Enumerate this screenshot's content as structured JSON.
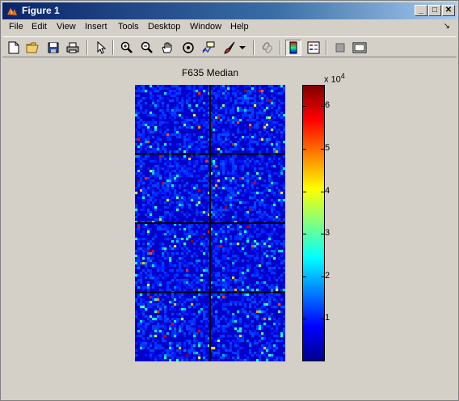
{
  "window": {
    "title": "Figure 1",
    "controls": {
      "minimize": "_",
      "maximize": "□",
      "close": "✕"
    }
  },
  "menubar": {
    "items": [
      "File",
      "Edit",
      "View",
      "Insert",
      "Tools",
      "Desktop",
      "Window",
      "Help"
    ],
    "dock_arrow": "↘"
  },
  "toolbar": {
    "icons": [
      "new-file-icon",
      "open-folder-icon",
      "save-icon",
      "print-icon",
      "pointer-icon",
      "zoom-in-icon",
      "zoom-out-icon",
      "pan-hand-icon",
      "rotate-3d-icon",
      "data-cursor-icon",
      "brush-icon",
      "brush-dropdown-icon",
      "link-icon",
      "colorbar-icon",
      "legend-icon",
      "hide-tools-icon",
      "show-tools-icon"
    ]
  },
  "colors": {
    "title_bar_start": "#0a246a",
    "title_bar_end": "#a6caf0",
    "background": "#d4d0c8",
    "heatmap_base": "#0000c8",
    "grid_line": "#000000"
  },
  "chart_data": {
    "type": "heatmap",
    "title": "F635 Median",
    "colorbar": {
      "exponent_label": "x 10",
      "exponent_power": "4",
      "ticks": [
        "1",
        "2",
        "3",
        "4",
        "5",
        "6"
      ],
      "tick_values": [
        10000,
        20000,
        30000,
        40000,
        50000,
        60000
      ],
      "range": [
        0,
        65000
      ],
      "colormap": "jet"
    },
    "grid_blocks": {
      "rows": 4,
      "cols": 2
    },
    "description_values": "mostly low intensity (~0–10000) with sparse bright spots up to ~65000"
  }
}
